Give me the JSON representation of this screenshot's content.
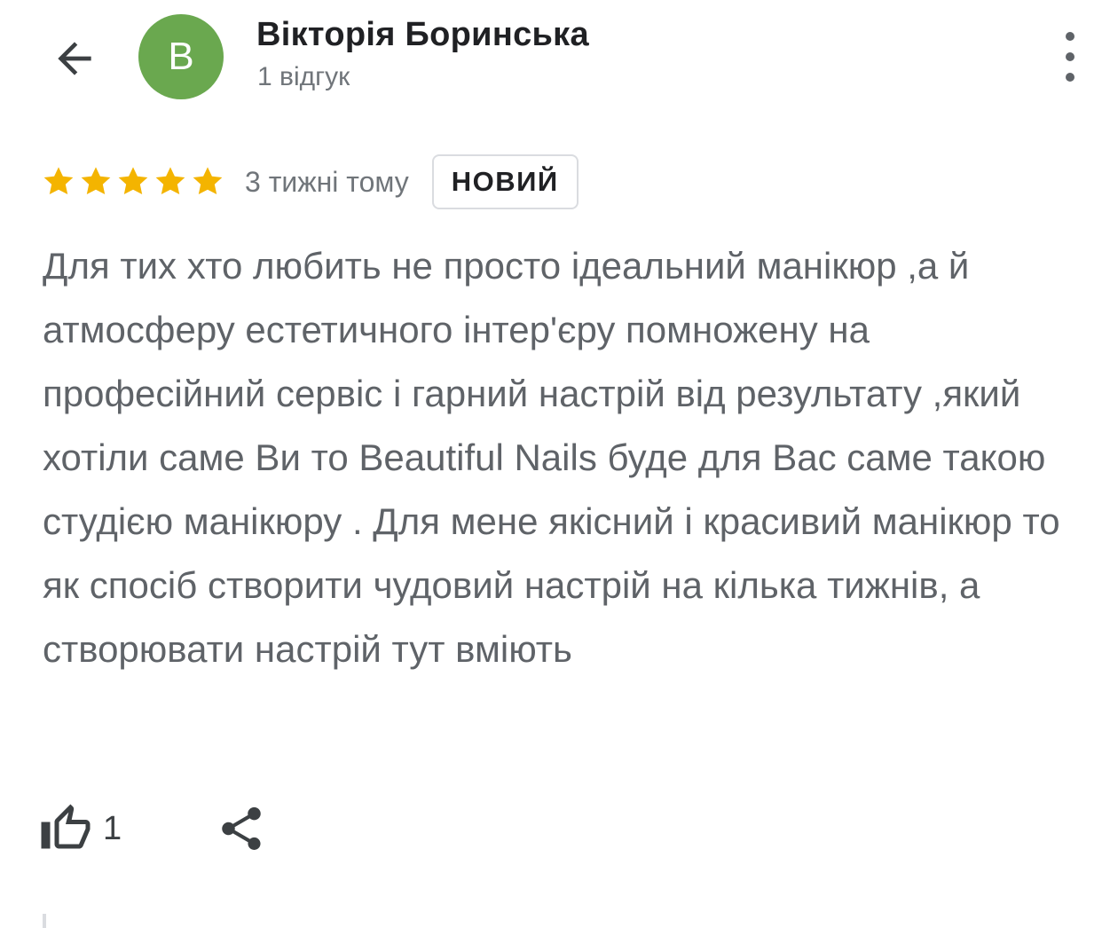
{
  "header": {
    "avatar_letter": "В",
    "avatar_color": "#6aa84f",
    "author_name": "Вікторія Боринська",
    "review_count": "1 відгук",
    "back_icon": "arrow-back-icon",
    "more_icon": "more-vert-icon"
  },
  "review": {
    "rating": 5,
    "max_rating": 5,
    "star_color": "#f4b400",
    "time": "3 тижні тому",
    "badge": "НОВИЙ",
    "text": "Для тих хто любить не просто ідеальний манікюр ,а й атмосферу естетичного інтер'єру помножену на професійний сервіс і гарний настрій від результату ,який хотіли саме Ви то Beautiful Nails буде для Вас саме такою студією манікюру . Для мене якісний і красивий манікюр то як спосіб створити чудовий настрій на кілька тижнів, а створювати настрій тут вміють"
  },
  "actions": {
    "like_icon": "thumb-up-icon",
    "like_count": "1",
    "share_icon": "share-icon"
  }
}
